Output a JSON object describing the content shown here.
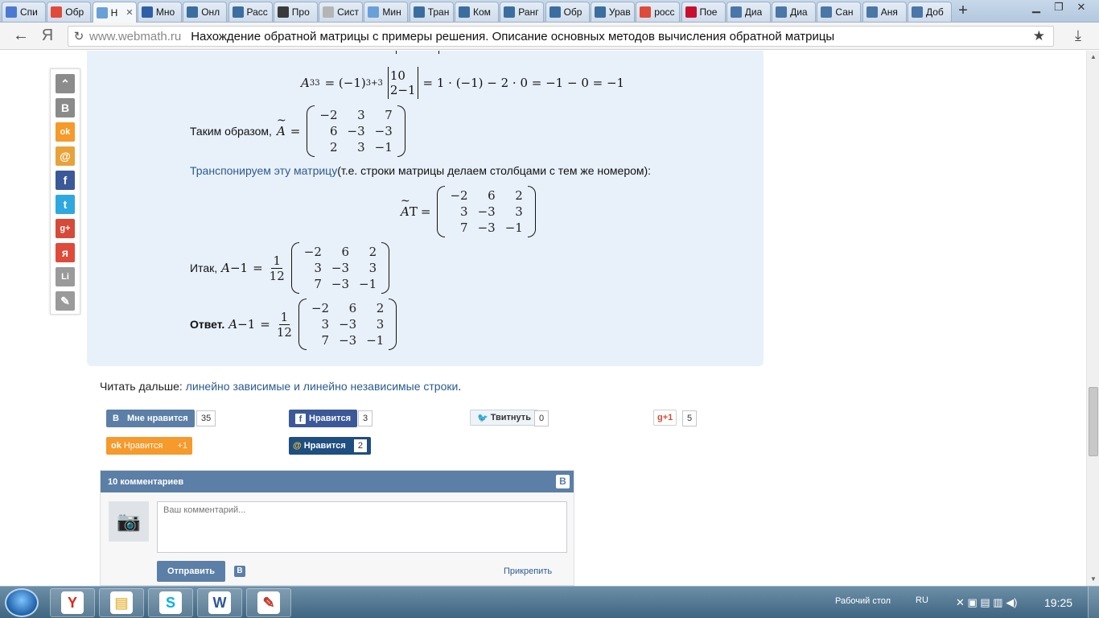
{
  "browser": {
    "tabs": [
      {
        "label": "Спи",
        "icon": "doc-icon",
        "color": "#4c7ad1"
      },
      {
        "label": "Обр",
        "icon": "yandex-icon",
        "color": "#e04a3a"
      },
      {
        "label": "Н",
        "icon": "page-icon",
        "color": "#6aa0d8",
        "active": true
      },
      {
        "label": "Мно",
        "icon": "tool-icon",
        "color": "#2f5fa7"
      },
      {
        "label": "Онл",
        "icon": "math-icon",
        "color": "#3b6e9f"
      },
      {
        "label": "Расс",
        "icon": "math-icon",
        "color": "#3b6e9f"
      },
      {
        "label": "Про",
        "icon": "clover-icon",
        "color": "#3a3a3a"
      },
      {
        "label": "Сист",
        "icon": "page-icon",
        "color": "#b5b5b5"
      },
      {
        "label": "Мин",
        "icon": "page-icon",
        "color": "#6aa0d8"
      },
      {
        "label": "Тран",
        "icon": "math-icon",
        "color": "#3b6e9f"
      },
      {
        "label": "Ком",
        "icon": "math-icon",
        "color": "#3b6e9f"
      },
      {
        "label": "Ранг",
        "icon": "book-icon",
        "color": "#3b6e9f"
      },
      {
        "label": "Обр",
        "icon": "book-icon",
        "color": "#3b6e9f"
      },
      {
        "label": "Урав",
        "icon": "math-icon",
        "color": "#3b6e9f"
      },
      {
        "label": "росс",
        "icon": "yandex-icon",
        "color": "#e04a3a"
      },
      {
        "label": "Пое",
        "icon": "channel-one-icon",
        "color": "#c8102e"
      },
      {
        "label": "Диа",
        "icon": "chat-icon",
        "color": "#4a76a8"
      },
      {
        "label": "Диа",
        "icon": "chat-icon",
        "color": "#4a76a8"
      },
      {
        "label": "Сан",
        "icon": "vk-icon",
        "color": "#4a76a8"
      },
      {
        "label": "Аня",
        "icon": "vk-icon",
        "color": "#4a76a8"
      },
      {
        "label": "Доб",
        "icon": "vk-icon",
        "color": "#4a76a8"
      }
    ],
    "new_tab": "+",
    "address_domain": "www.webmath.ru",
    "address_title": "Нахождение обратной матрицы с примеры решения. Описание основных методов вычисления обратной матрицы",
    "ya_letter": "Я"
  },
  "solution": {
    "cofactor": {
      "lhs": "A",
      "lhs_sub": "33",
      "sign_base": "= (−1)",
      "sign_exp": "3+3",
      "det": [
        [
          "1",
          "0"
        ],
        [
          "2",
          "−1"
        ]
      ],
      "rhs": "= 1 · (−1) − 2 · 0 = −1 − 0 = −1"
    },
    "thus_label": "Таким образом,",
    "adj_symbol": "A",
    "adj_matrix": [
      [
        "−2",
        "3",
        "7"
      ],
      [
        "6",
        "−3",
        "−3"
      ],
      [
        "2",
        "3",
        "−1"
      ]
    ],
    "transpose_link": "Транспонируем эту матрицу",
    "transpose_rest": " (т.е. строки матрицы делаем столбцами с тем же номером):",
    "transpose_sup": "T",
    "transposed_matrix": [
      [
        "−2",
        "6",
        "2"
      ],
      [
        "3",
        "−3",
        "3"
      ],
      [
        "7",
        "−3",
        "−1"
      ]
    ],
    "so_label": "Итак,",
    "inverse_symbol": "A",
    "inverse_sup": "−1",
    "frac_num": "1",
    "frac_den": "12",
    "answer_label": "Ответ.",
    "inverse_matrix": [
      [
        "−2",
        "6",
        "2"
      ],
      [
        "3",
        "−3",
        "3"
      ],
      [
        "7",
        "−3",
        "−1"
      ]
    ],
    "equals": "="
  },
  "readmore": {
    "prefix": "Читать дальше: ",
    "link": "линейно зависимые и линейно независимые строки",
    "suffix": "."
  },
  "likes": {
    "vk": {
      "label": "Мне нравится",
      "count": "35",
      "color": "#5b7fa6"
    },
    "fb": {
      "label": "Нравится",
      "count": "3",
      "color": "#3b5998"
    },
    "tw": {
      "label": "Твитнуть",
      "count": "0"
    },
    "gplus": {
      "label": "+1",
      "count": "5"
    },
    "ok": {
      "label": "Нравится",
      "count": "+1",
      "color": "#f59a2b"
    },
    "mail": {
      "label": "Нравится",
      "count": "2",
      "color": "#1f4e80"
    }
  },
  "comments": {
    "title": "10 комментариев",
    "placeholder": "Ваш комментарий...",
    "send": "Отправить",
    "attach": "Прикрепить",
    "vk_letter": "B"
  },
  "share_sidebar": [
    {
      "icon": "scroll-up-icon",
      "color": "#8c8c8c",
      "glyph": "⌃"
    },
    {
      "icon": "vk-icon",
      "color": "#8a8a8a",
      "glyph": "B"
    },
    {
      "icon": "odnoklassniki-icon",
      "color": "#f59a2b",
      "glyph": "ok"
    },
    {
      "icon": "mailru-icon",
      "color": "#e8a23a",
      "glyph": "@"
    },
    {
      "icon": "facebook-icon",
      "color": "#3b5998",
      "glyph": "f"
    },
    {
      "icon": "twitter-icon",
      "color": "#2fa8e0",
      "glyph": "t"
    },
    {
      "icon": "googleplus-icon",
      "color": "#d64a38",
      "glyph": "g+"
    },
    {
      "icon": "moimir-icon",
      "color": "#e04a3a",
      "glyph": "я"
    },
    {
      "icon": "liveinternet-icon",
      "color": "#9a9a9a",
      "glyph": "Li"
    },
    {
      "icon": "bookmark-icon",
      "color": "#9a9a9a",
      "glyph": "✎"
    }
  ],
  "taskbar": {
    "apps": [
      {
        "icon": "yandex-browser-icon",
        "glyph": "Y",
        "color": "#e0261a"
      },
      {
        "icon": "explorer-icon",
        "glyph": "▤",
        "color": "#e8c15a"
      },
      {
        "icon": "skype-icon",
        "glyph": "S",
        "color": "#00aff0"
      },
      {
        "icon": "word-icon",
        "glyph": "W",
        "color": "#2b579a"
      },
      {
        "icon": "paint-icon",
        "glyph": "✎",
        "color": "#c0392b"
      }
    ],
    "desktop_label": "Рабочий стол",
    "lang": "RU",
    "time": "19:25"
  }
}
